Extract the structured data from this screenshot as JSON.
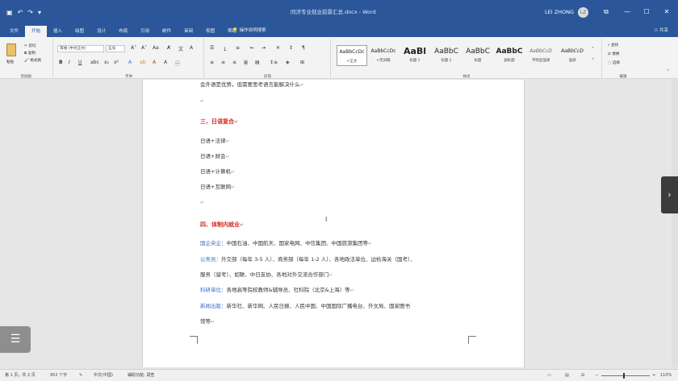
{
  "window": {
    "title": "同济专业就业前景汇总.docx - Word",
    "user": "LEI ZHONG",
    "avatar": "LZ",
    "qat": [
      "▣",
      "↶",
      "↷",
      "▾"
    ],
    "controls": [
      "⧉",
      "—",
      "☐",
      "✕"
    ]
  },
  "tabs": [
    "文件",
    "开始",
    "插入",
    "绘图",
    "设计",
    "布局",
    "引用",
    "邮件",
    "审阅",
    "视图",
    "帮助"
  ],
  "active_tab": "开始",
  "tell_me": "操作说明搜索",
  "share": "共享",
  "ribbon": {
    "clipboard": {
      "label": "剪贴板",
      "paste": "粘贴",
      "cut": "剪切",
      "copy": "复制",
      "format_painter": "格式刷"
    },
    "font": {
      "label": "字体",
      "font_name": "等线 (中文正文)",
      "font_size": "五号",
      "bold": "B",
      "italic": "I",
      "underline": "U"
    },
    "paragraph": {
      "label": "段落"
    },
    "styles": {
      "label": "样式",
      "items": [
        {
          "sample": "AaBbCcDc",
          "name": "↵正文"
        },
        {
          "sample": "AaBbCcDc",
          "name": "↵无间隔"
        },
        {
          "sample": "AaBl",
          "name": "标题 1"
        },
        {
          "sample": "AaBbC",
          "name": "标题 2"
        },
        {
          "sample": "AaBbC",
          "name": "标题"
        },
        {
          "sample": "AaBbC",
          "name": "副标题"
        },
        {
          "sample": "AaBbCcD",
          "name": "不明显强调"
        },
        {
          "sample": "AaBbCcD",
          "name": "强调"
        }
      ]
    },
    "editing": {
      "label": "编辑",
      "find": "查找",
      "replace": "替换",
      "select": "选择"
    }
  },
  "document": {
    "line_top": "会外语是优势，但需要思考语言能解决什么",
    "heading3": "三、日语复合",
    "combos": [
      "日语+法律",
      "日语+财会",
      "日语+计算机",
      "日语+互联网"
    ],
    "heading4": "四、体制内就业",
    "entries": [
      {
        "label": "国企央企：",
        "text": "中国石油、中国航天、国家电网、中信集团、中国旅游集团等"
      },
      {
        "label": "公务员：",
        "text": "外交部（每年 3-5 人）、商务部（每年 1-2 人）、各地政法单位、边检海关（国考）、"
      },
      {
        "label": "",
        "text": "服务（留考）、如联、中日友协、各地对外交流合作部门"
      },
      {
        "label": "科研单位：",
        "text": "各地高等院校教师&辅导员、社科院（北京&上海）等"
      },
      {
        "label": "新闻出版：",
        "text": "新华社、新华网、人民日报、人民中国、中国国际广播电台、外文局、国家图书"
      },
      {
        "label": "",
        "text": "馆等"
      }
    ],
    "paragraph_mark": "↵"
  },
  "status": {
    "page": "第 1 页，共 2 页",
    "words": "952 个字",
    "lang": "中文(中国)",
    "accessibility": "辅助功能: 调查",
    "zoom": "110%"
  }
}
